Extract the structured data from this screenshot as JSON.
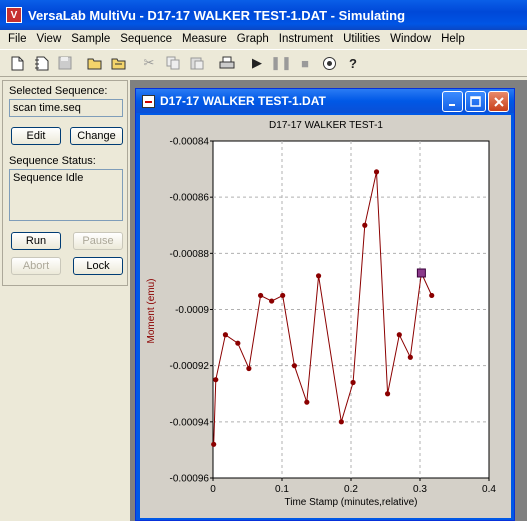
{
  "window": {
    "title": "VersaLab MultiVu - D17-17 WALKER TEST-1.DAT - Simulating",
    "icon": "V"
  },
  "menu": [
    "File",
    "View",
    "Sample",
    "Sequence",
    "Measure",
    "Graph",
    "Instrument",
    "Utilities",
    "Window",
    "Help"
  ],
  "toolbar": {
    "icons": [
      "new-file-icon",
      "new-sequence-icon",
      "save-icon",
      "open-folder-icon",
      "open-sequence-icon",
      "cut-icon",
      "copy-icon",
      "paste-icon",
      "print-icon",
      "run-icon",
      "pause-icon",
      "stop-icon",
      "status-icon",
      "help-icon"
    ]
  },
  "sequence_panel": {
    "selected_label": "Selected Sequence:",
    "selected_value": "scan time.seq",
    "edit_label": "Edit",
    "change_label": "Change",
    "status_label": "Sequence Status:",
    "status_value": "Sequence Idle",
    "run_label": "Run",
    "pause_label": "Pause",
    "abort_label": "Abort",
    "lock_label": "Lock"
  },
  "graph_window": {
    "title": "D17-17 WALKER TEST-1.DAT"
  },
  "chart_data": {
    "type": "line",
    "title": "D17-17 WALKER TEST-1",
    "xlabel": "Time Stamp (minutes,relative)",
    "ylabel": "Moment (emu)",
    "xlim": [
      0,
      0.4
    ],
    "ylim": [
      -0.00096,
      -0.00084
    ],
    "x_ticks": [
      "0",
      "0.1",
      "0.2",
      "0.3",
      "0.4"
    ],
    "y_ticks": [
      "-0.00084",
      "-0.00086",
      "-0.00088",
      "-0.0009",
      "-0.00092",
      "-0.00094",
      "-0.00096"
    ],
    "grid": true,
    "series_color": "#8b0000",
    "x": [
      0.001,
      0.004,
      0.018,
      0.036,
      0.052,
      0.069,
      0.085,
      0.101,
      0.118,
      0.136,
      0.153,
      0.186,
      0.203,
      0.22,
      0.237,
      0.253,
      0.27,
      0.286,
      0.302,
      0.317
    ],
    "y": [
      -0.000948,
      -0.000925,
      -0.000909,
      -0.000912,
      -0.000921,
      -0.000895,
      -0.000897,
      -0.000895,
      -0.00092,
      -0.000933,
      -0.000888,
      -0.00094,
      -0.000926,
      -0.00087,
      -0.000851,
      -0.00093,
      -0.000909,
      -0.000917,
      -0.000887,
      -0.000895
    ],
    "highlight_index": 18
  }
}
